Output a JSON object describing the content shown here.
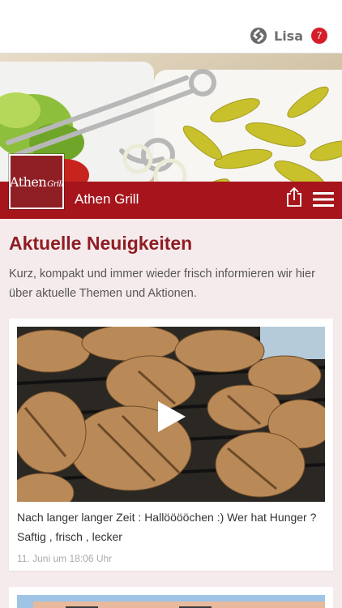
{
  "header": {
    "user_name": "Lisa",
    "notification_count": "7",
    "user_icon": "app-logo-icon"
  },
  "brand": {
    "name": "Athen Grill",
    "logo_text_main": "Athen",
    "logo_text_script": "Grill",
    "color": "#a6151c",
    "icons": [
      "share-icon",
      "hamburger-menu-icon"
    ]
  },
  "news": {
    "title": "Aktuelle Neuigkeiten",
    "intro": "Kurz, kompakt und immer wieder frisch informieren wir hier über aktuelle Themen und Aktionen.",
    "posts": [
      {
        "text": "Nach langer langer Zeit : Hallööööchen :) Wer hat Hunger ? Saftig , frisch , lecker",
        "date": "11. Juni um 18:06 Uhr",
        "media": "video",
        "media_icon": "play-icon"
      }
    ]
  },
  "colors": {
    "title": "#8f1d23",
    "badge": "#d41e2a",
    "background": "#f6ebec"
  }
}
